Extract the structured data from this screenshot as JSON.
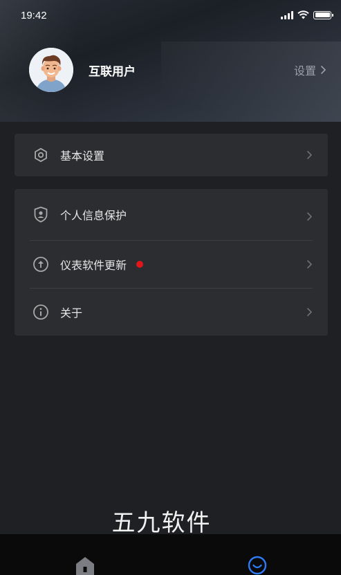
{
  "status_bar": {
    "time": "19:42",
    "battery_level": 1.0
  },
  "profile": {
    "username": "互联用户",
    "settings_label": "设置"
  },
  "menu_group_1": [
    {
      "label": "基本设置",
      "icon": "hexagon-settings-icon"
    }
  ],
  "menu_group_2": [
    {
      "label": "个人信息保护",
      "icon": "shield-user-icon"
    },
    {
      "label": "仪表软件更新",
      "icon": "upload-circle-icon",
      "badge": "red-dot"
    },
    {
      "label": "关于",
      "icon": "info-circle-icon"
    }
  ],
  "watermark": "五九软件",
  "tabbar": {
    "home_icon": "home-icon",
    "me_icon": "smile-icon",
    "active_color": "#2f7bf5"
  },
  "colors": {
    "background": "#1f2023",
    "card": "#2c2d30",
    "badge": "#e0161b",
    "tabbar": "#0a0a0b"
  }
}
